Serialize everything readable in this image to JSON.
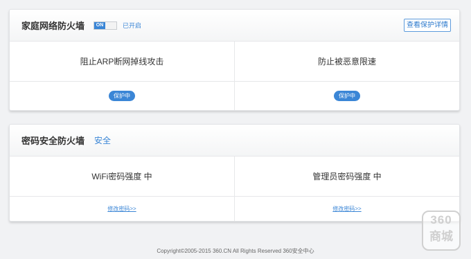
{
  "home_firewall": {
    "title": "家庭网络防火墙",
    "toggle_label": "ON",
    "status": "已开启",
    "detail_button": "查看保护详情",
    "items": [
      {
        "label": "阻止ARP断网掉线攻击",
        "status": "保护中"
      },
      {
        "label": "防止被恶意限速",
        "status": "保护中"
      }
    ]
  },
  "password_firewall": {
    "title": "密码安全防火墙",
    "status": "安全",
    "items": [
      {
        "label": "WiFi密码强度 中",
        "action": "修改密码>>"
      },
      {
        "label": "管理员密码强度 中",
        "action": "修改密码>>"
      }
    ]
  },
  "footer": {
    "copyright": "Copyright©2005-2015 360.CN All Rights Reserved 360安全中心"
  },
  "watermark": {
    "top": "360",
    "bottom": "商城"
  },
  "colors": {
    "accent": "#3b86d6",
    "background": "#f1f2f4"
  }
}
